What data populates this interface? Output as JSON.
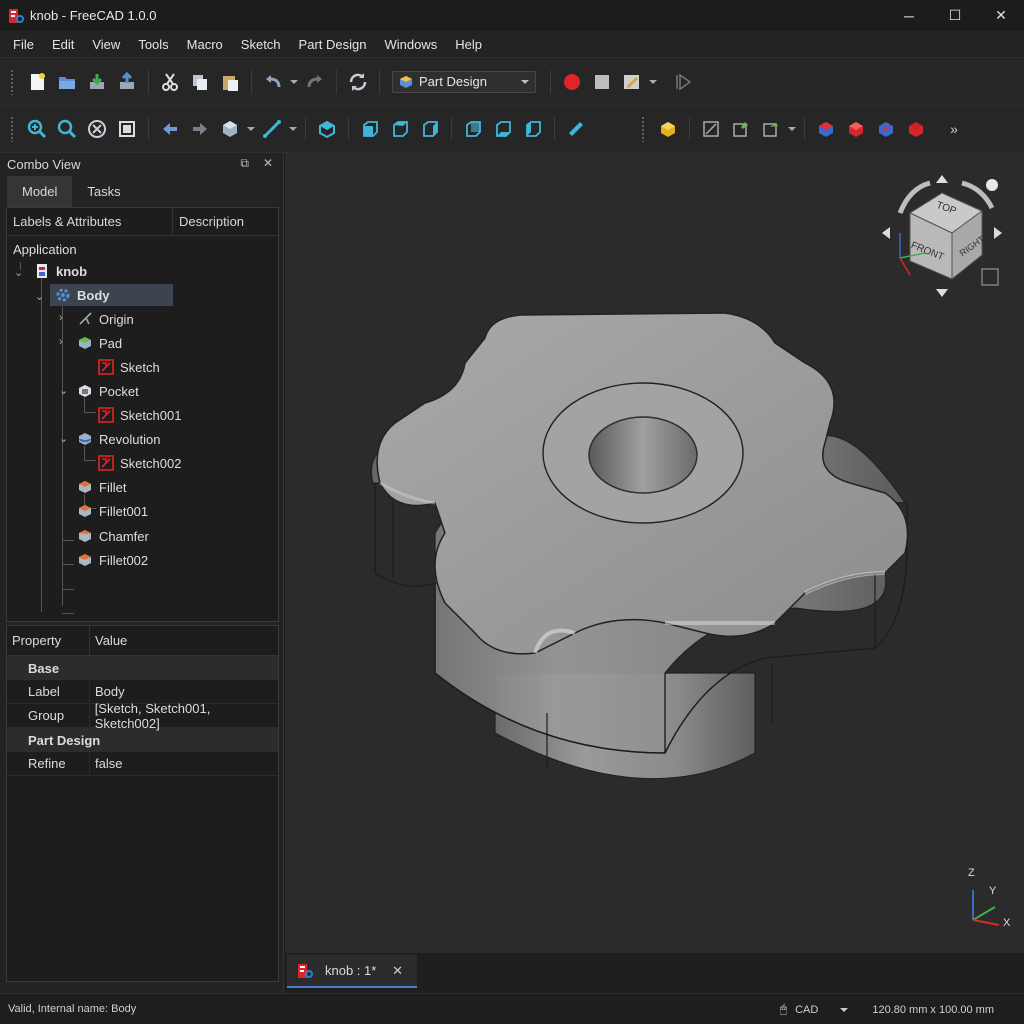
{
  "window": {
    "title": "knob - FreeCAD 1.0.0",
    "minimize": "─",
    "maximize": "☐",
    "close": "✕"
  },
  "menu": [
    "File",
    "Edit",
    "View",
    "Tools",
    "Macro",
    "Sketch",
    "Part Design",
    "Windows",
    "Help"
  ],
  "toolbar": {
    "workbench": "Part Design"
  },
  "combo_view": {
    "title": "Combo View",
    "tabs": [
      "Model",
      "Tasks"
    ],
    "active_tab": "Model",
    "tree_columns": [
      "Labels & Attributes",
      "Description"
    ],
    "tree": {
      "root": "Application",
      "document": "knob",
      "body": "Body",
      "items": [
        "Origin",
        "Pad",
        "Sketch",
        "Pocket",
        "Sketch001",
        "Revolution",
        "Sketch002",
        "Fillet",
        "Fillet001",
        "Chamfer",
        "Fillet002"
      ]
    },
    "property_columns": [
      "Property",
      "Value"
    ],
    "property_groups": [
      {
        "name": "Base",
        "rows": [
          {
            "key": "Label",
            "value": "Body"
          },
          {
            "key": "Group",
            "value": "[Sketch, Sketch001, Sketch002]"
          }
        ]
      },
      {
        "name": "Part Design",
        "rows": [
          {
            "key": "Refine",
            "value": "false"
          }
        ]
      }
    ]
  },
  "navcube": {
    "top": "TOP",
    "front": "FRONT",
    "right": "RIGHT"
  },
  "axes": {
    "x": "X",
    "y": "Y",
    "z": "Z"
  },
  "document_tab": {
    "label": "knob : 1*",
    "close": "✕"
  },
  "status": {
    "message": "Valid, Internal name: Body",
    "nav_style": "CAD",
    "dimensions": "120.80 mm x 100.00 mm"
  },
  "colors": {
    "accent": "#4a7ec7",
    "selection": "#3c4450",
    "record": "#e0242a",
    "sketch_red": "#e0242a"
  }
}
